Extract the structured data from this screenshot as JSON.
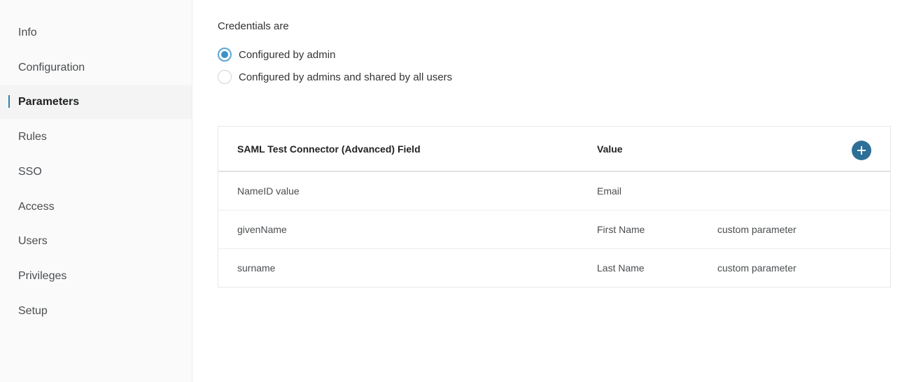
{
  "sidebar": {
    "items": [
      {
        "label": "Info"
      },
      {
        "label": "Configuration"
      },
      {
        "label": "Parameters",
        "active": true
      },
      {
        "label": "Rules"
      },
      {
        "label": "SSO"
      },
      {
        "label": "Access"
      },
      {
        "label": "Users"
      },
      {
        "label": "Privileges"
      },
      {
        "label": "Setup"
      }
    ]
  },
  "credentials": {
    "label": "Credentials are",
    "options": [
      {
        "label": "Configured by admin",
        "checked": true
      },
      {
        "label": "Configured by admins and shared by all users",
        "checked": false
      }
    ]
  },
  "table": {
    "headers": {
      "field": "SAML Test Connector (Advanced) Field",
      "value": "Value"
    },
    "add_icon": "plus-icon",
    "rows": [
      {
        "field": "NameID value",
        "value": "Email",
        "note": ""
      },
      {
        "field": "givenName",
        "value": "First Name",
        "note": "custom parameter"
      },
      {
        "field": "surname",
        "value": "Last Name",
        "note": "custom parameter"
      }
    ]
  },
  "colors": {
    "accent": "#3c90c8",
    "add_button": "#2d6f96",
    "active_indicator": "#2f7fb2"
  }
}
